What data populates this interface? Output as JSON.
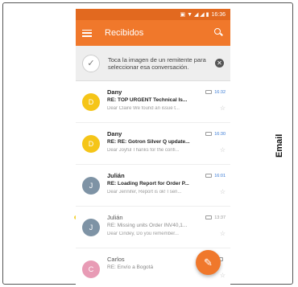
{
  "side_label": "Email",
  "status_bar": {
    "time": "16:36"
  },
  "toolbar": {
    "title": "Recibidos"
  },
  "banner": {
    "text": "Toca la imagen de un remitente para seleccionar esa conversación."
  },
  "emails": [
    {
      "initial": "D",
      "sender": "Dany",
      "time": "16:32",
      "subject": "RE: TOP URGENT Technical Is...",
      "preview": "Dear Claire We found an issue t...",
      "color": "#f5c518",
      "unread": true
    },
    {
      "initial": "D",
      "sender": "Dany",
      "time": "16:30",
      "subject": "RE: RE: Gotron Silver Q update...",
      "preview": "Dear Joyful Thanks for the confi...",
      "color": "#f5c518",
      "unread": true
    },
    {
      "initial": "J",
      "sender": "Julián",
      "time": "16:01",
      "subject": "RE: Loading Report for Order P...",
      "preview": "Dear Jennifer, Report is ok! I sen...",
      "color": "#7e93a5",
      "unread": true
    },
    {
      "initial": "J",
      "sender": "Julián",
      "time": "13:37",
      "subject": "RE: Missing units Order INV40,1...",
      "preview": "Dear Cindey, Do you remember...",
      "color": "#7e93a5",
      "unread": false
    },
    {
      "initial": "C",
      "sender": "Carlos",
      "time": "",
      "subject": "RE: Envío a Bogotá",
      "preview": "",
      "color": "#e89bb5",
      "unread": false
    }
  ],
  "colors": {
    "primary": "#f0782b",
    "status_bar": "#e2691f"
  }
}
